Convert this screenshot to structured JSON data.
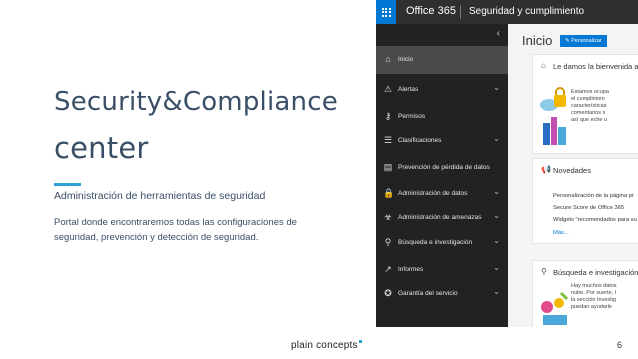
{
  "slide": {
    "title_line1": "Security&Compliance",
    "title_line2": "center",
    "subtitle": "Administración de herramientas de seguridad",
    "body": "Portal donde encontraremos todas las configuraciones de seguridad, prevención y detección de seguridad.",
    "footer_logo": "plain concepts",
    "page_number": "6",
    "accent_color": "#2aa3d8"
  },
  "app": {
    "brand": "Office 365",
    "section": "Seguridad y cumplimiento",
    "collapse_icon": "chevron-left-icon",
    "nav": [
      {
        "label": "Inicio",
        "icon": "home-icon",
        "glyph": "⌂",
        "has_chevron": false,
        "active": true
      },
      {
        "label": "Alertas",
        "icon": "alert-icon",
        "glyph": "⚠",
        "has_chevron": true,
        "active": false
      },
      {
        "label": "Permisos",
        "icon": "permissions-icon",
        "glyph": "⚷",
        "has_chevron": false,
        "active": false
      },
      {
        "label": "Clasificaciones",
        "icon": "classification-icon",
        "glyph": "☰",
        "has_chevron": true,
        "active": false
      },
      {
        "label": "Prevención de pérdida de datos",
        "icon": "data-loss-prevention-icon",
        "glyph": "▤",
        "has_chevron": false,
        "active": false
      },
      {
        "label": "Administración de datos",
        "icon": "lock-icon",
        "glyph": "🔒",
        "has_chevron": true,
        "active": false
      },
      {
        "label": "Administración de amenazas",
        "icon": "threat-icon",
        "glyph": "☣",
        "has_chevron": true,
        "active": false
      },
      {
        "label": "Búsqueda e investigación",
        "icon": "search-icon",
        "glyph": "⚲",
        "has_chevron": true,
        "active": false
      },
      {
        "label": "Informes",
        "icon": "chart-icon",
        "glyph": "↗",
        "has_chevron": true,
        "active": false
      },
      {
        "label": "Garantía del servicio",
        "icon": "service-assurance-icon",
        "glyph": "✪",
        "has_chevron": true,
        "active": false
      }
    ],
    "page_title": "Inicio",
    "personalize_button": "✎ Personalizar",
    "welcome_card": {
      "title": "Le damos la bienvenida al",
      "text": [
        "Estamos ocupa",
        "el cumplimien",
        "características",
        "comentarios s",
        "así que eche u"
      ]
    },
    "news_card": {
      "title": "Novedades",
      "items": [
        "Personalización de la página pr",
        "Secure Score de Office 365",
        "Widgets \"recomendados para su"
      ],
      "more": "Más..."
    },
    "search_card": {
      "title": "Búsqueda e investigación",
      "text": [
        "Hay muchos datos",
        "nube. Por suerte, l",
        "la sección Investig",
        "puedan ayudarle"
      ]
    },
    "colors": {
      "brand_blue": "#0078d4",
      "nav_bg": "#222222",
      "topbar_bg": "#2f2f2f"
    }
  }
}
